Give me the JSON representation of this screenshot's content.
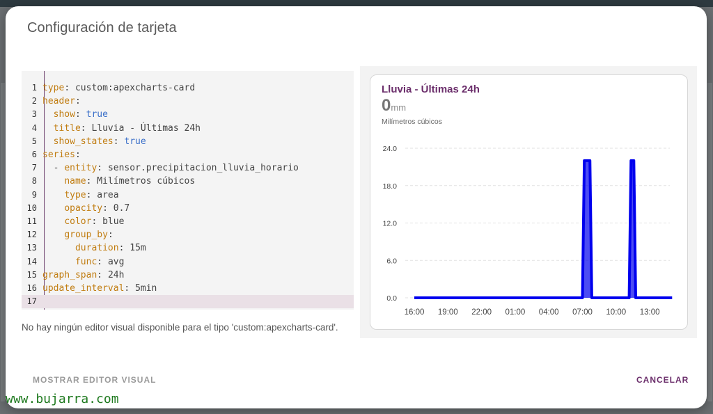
{
  "dialog": {
    "title": "Configuración de tarjeta",
    "notice": "No hay ningún editor visual disponible para el tipo 'custom:apexcharts-card'.",
    "show_visual_editor_label": "MOSTRAR EDITOR VISUAL",
    "cancel_label": "CANCELAR"
  },
  "editor": {
    "lines": [
      {
        "n": "1",
        "indent": "",
        "key": "type",
        "sep": ": ",
        "value": "custom:apexcharts-card",
        "vtype": "v"
      },
      {
        "n": "2",
        "indent": "",
        "key": "header",
        "sep": ":",
        "value": "",
        "vtype": "v"
      },
      {
        "n": "3",
        "indent": "  ",
        "key": "show",
        "sep": ": ",
        "value": "true",
        "vtype": "b"
      },
      {
        "n": "4",
        "indent": "  ",
        "key": "title",
        "sep": ": ",
        "value": "Lluvia - Últimas 24h",
        "vtype": "v"
      },
      {
        "n": "5",
        "indent": "  ",
        "key": "show_states",
        "sep": ": ",
        "value": "true",
        "vtype": "b"
      },
      {
        "n": "6",
        "indent": "",
        "key": "series",
        "sep": ":",
        "value": "",
        "vtype": "v"
      },
      {
        "n": "7",
        "indent": "  - ",
        "key": "entity",
        "sep": ": ",
        "value": "sensor.precipitacion_lluvia_horario",
        "vtype": "v"
      },
      {
        "n": "8",
        "indent": "    ",
        "key": "name",
        "sep": ": ",
        "value": "Milímetros cúbicos",
        "vtype": "v"
      },
      {
        "n": "9",
        "indent": "    ",
        "key": "type",
        "sep": ": ",
        "value": "area",
        "vtype": "v"
      },
      {
        "n": "10",
        "indent": "    ",
        "key": "opacity",
        "sep": ": ",
        "value": "0.7",
        "vtype": "v"
      },
      {
        "n": "11",
        "indent": "    ",
        "key": "color",
        "sep": ": ",
        "value": "blue",
        "vtype": "v"
      },
      {
        "n": "12",
        "indent": "    ",
        "key": "group_by",
        "sep": ":",
        "value": "",
        "vtype": "v"
      },
      {
        "n": "13",
        "indent": "      ",
        "key": "duration",
        "sep": ": ",
        "value": "15m",
        "vtype": "v"
      },
      {
        "n": "14",
        "indent": "      ",
        "key": "func",
        "sep": ": ",
        "value": "avg",
        "vtype": "v"
      },
      {
        "n": "15",
        "indent": "",
        "key": "graph_span",
        "sep": ": ",
        "value": "24h",
        "vtype": "v"
      },
      {
        "n": "16",
        "indent": "",
        "key": "update_interval",
        "sep": ": ",
        "value": "5min",
        "vtype": "v"
      },
      {
        "n": "17",
        "indent": "",
        "key": "",
        "sep": "",
        "value": "",
        "vtype": "v"
      }
    ]
  },
  "card": {
    "title": "Lluvia - Últimas 24h",
    "state_value": "0",
    "state_unit": "mm",
    "legend": "Milímetros cúbicos"
  },
  "chart_data": {
    "type": "area",
    "series": [
      {
        "name": "Milímetros cúbicos",
        "color": "#0000ee",
        "points": [
          [
            "16:00",
            0
          ],
          [
            "07:00",
            0
          ],
          [
            "07:10",
            22
          ],
          [
            "07:40",
            22
          ],
          [
            "07:50",
            0
          ],
          [
            "11:10",
            0
          ],
          [
            "11:20",
            22
          ],
          [
            "11:35",
            22
          ],
          [
            "11:45",
            0
          ],
          [
            "15:00",
            0
          ]
        ]
      }
    ],
    "x_ticks": [
      "16:00",
      "19:00",
      "22:00",
      "01:00",
      "04:00",
      "07:00",
      "10:00",
      "13:00"
    ],
    "y_ticks": [
      "0.0",
      "6.0",
      "12.0",
      "18.0",
      "24.0"
    ],
    "ylim": [
      0,
      24
    ],
    "grid": true
  },
  "watermark": "www.bujarra.com",
  "colors": {
    "accent": "#6b2e6b",
    "yaml_key": "#c17d11",
    "yaml_bool": "#3a6fc9",
    "series": "#0000ee"
  }
}
